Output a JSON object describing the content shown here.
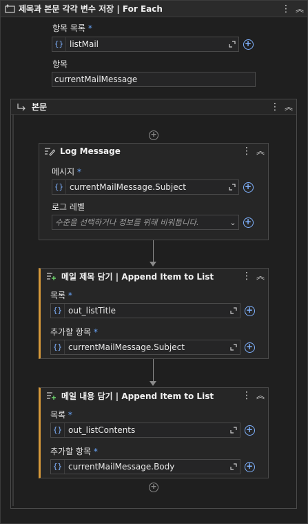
{
  "foreach": {
    "title": "제목과 본문 각각 변수 저장 | For Each",
    "list_label": "항목 목록",
    "list_required": "*",
    "list_value": "listMail",
    "item_label": "항목",
    "item_value": "currentMailMessage"
  },
  "body": {
    "title": "본문"
  },
  "log_message": {
    "title": "Log Message",
    "message_label": "메시지",
    "message_required": "*",
    "message_value": "currentMailMessage.Subject",
    "level_label": "로그 레벨",
    "level_placeholder": "수준을 선택하거나 정보를 위해 비워둡니다."
  },
  "append_title": {
    "title": "메일 제목 담기 | Append Item to List",
    "list_label": "목록",
    "list_required": "*",
    "list_value": "out_listTitle",
    "item_label": "추가할 항목",
    "item_required": "*",
    "item_value": "currentMailMessage.Subject"
  },
  "append_contents": {
    "title": "메일 내용 담기 | Append Item to List",
    "list_label": "목록",
    "list_required": "*",
    "list_value": "out_listContents",
    "item_label": "추가할 항목",
    "item_required": "*",
    "item_value": "currentMailMessage.Body"
  },
  "icons": {
    "brace": "{}",
    "more": "⋮",
    "collapse": "︽",
    "plus": "+",
    "expand": "expand-icon",
    "chevron_down": "⌄"
  },
  "colors": {
    "accent_blue": "#7fb2ff",
    "activity_accent": "#d89a3b",
    "background": "#1f1f1f"
  }
}
